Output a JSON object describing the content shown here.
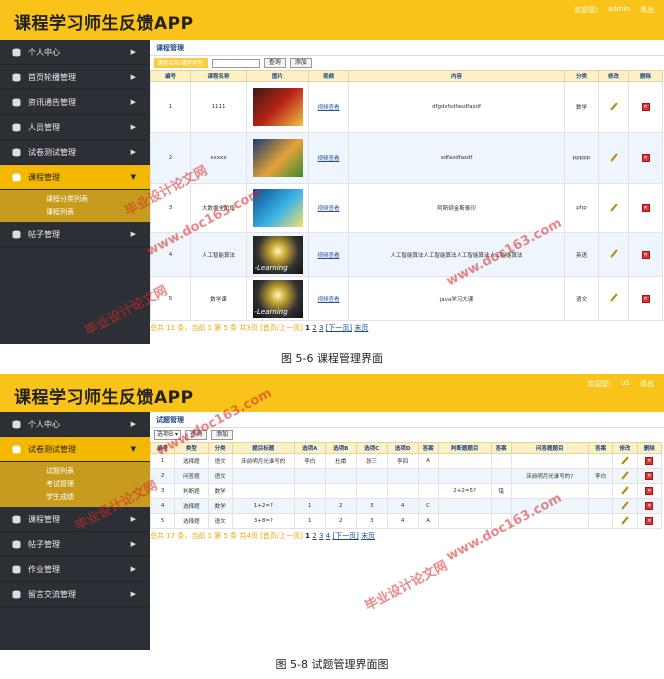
{
  "watermark": {
    "line1": "毕业设计论文网",
    "line2": "www.doc163.com"
  },
  "shot1": {
    "app_title": "课程学习师生反馈APP",
    "welcome": "欢迎您!",
    "user": "admin",
    "logout": "退出",
    "menu": [
      {
        "label": "个人中心"
      },
      {
        "label": "首页轮播管理"
      },
      {
        "label": "资讯通告管理"
      },
      {
        "label": "人员管理"
      },
      {
        "label": "试卷测试管理"
      },
      {
        "label": "课程管理"
      },
      {
        "label": "帖子管理"
      }
    ],
    "submenu": [
      "课程分类列表",
      "课程列表"
    ],
    "page_title": "课程管理",
    "search_label": "课程名称/课程类型:",
    "search_button": "查询",
    "add_button": "添加",
    "columns": [
      "编号",
      "课程名称",
      "图片",
      "视频",
      "内容",
      "分类",
      "修改",
      "删除"
    ],
    "video_link": "视频查看",
    "rows": [
      {
        "id": "1",
        "name": "1111",
        "content": "dfgdsfsdfasdfasdf",
        "category": "数学"
      },
      {
        "id": "2",
        "name": "xxxxx",
        "content": "sdfasdfasdf",
        "category": "ppppp"
      },
      {
        "id": "3",
        "name": "大数据全阶段",
        "content": "阿斯顿金斯泰印",
        "category": "php"
      },
      {
        "id": "4",
        "name": "人工智能算法",
        "content": "人工智能算法人工智能算法人工智能算法人工智能算法",
        "category": "英语"
      },
      {
        "id": "5",
        "name": "数学课",
        "content": "java学习大课",
        "category": "语文"
      }
    ],
    "thumb_label": "-Learning",
    "pager": {
      "summary": "总共 11 条，当前 1 第 5 条 共3页",
      "first_prev": "[首页/上一页]",
      "p1": "1",
      "p2": "2",
      "p3": "3",
      "next": "[下一页]",
      "last": "末页"
    }
  },
  "caption1": "图 5-6 课程管理界面",
  "shot2": {
    "app_title": "课程学习师生反馈APP",
    "welcome": "欢迎您!",
    "user": "u1",
    "logout": "退出",
    "menu": [
      {
        "label": "个人中心"
      },
      {
        "label": "试卷测试管理"
      },
      {
        "label": "课程管理"
      },
      {
        "label": "帖子管理"
      },
      {
        "label": "作业管理"
      },
      {
        "label": "留言交流管理"
      }
    ],
    "submenu": [
      "试题列表",
      "考试管理",
      "学生成绩"
    ],
    "page_title": "试题管理",
    "select_value": "选项B",
    "search_button": "查询",
    "add_button": "添加",
    "columns": [
      "编号",
      "类型",
      "分类",
      "题目标题",
      "选项A",
      "选项B",
      "选项C",
      "选项D",
      "答案",
      "判断题题目",
      "答案",
      "问答题题目",
      "答案",
      "修改",
      "删除"
    ],
    "rows": [
      [
        "1",
        "选择题",
        "语文",
        "床前明月光谁写的",
        "李白",
        "杜甫",
        "张三",
        "李四",
        "A",
        "",
        "",
        "",
        ""
      ],
      [
        "2",
        "问答题",
        "语文",
        "",
        "",
        "",
        "",
        "",
        "",
        "",
        "",
        "床前明月光谁写的?",
        "李白"
      ],
      [
        "3",
        "判断题",
        "数学",
        "",
        "",
        "",
        "",
        "",
        "",
        "2+2=5?",
        "错",
        "",
        ""
      ],
      [
        "4",
        "选择题",
        "数学",
        "1+2=?",
        "1",
        "2",
        "3",
        "4",
        "C",
        "",
        "",
        "",
        ""
      ],
      [
        "5",
        "选择题",
        "语文",
        "3+8=?",
        "1",
        "2",
        "3",
        "4",
        "A",
        "",
        "",
        "",
        ""
      ]
    ],
    "pager": {
      "summary": "总共 17 条，当前 1 第 5 条 共4页",
      "first_prev": "[首页/上一页]",
      "p1": "1",
      "p2": "2",
      "p3": "3",
      "p4": "4",
      "next": "[下一页]",
      "last": "末页"
    }
  },
  "caption2": "图 5-8 试题管理界面图"
}
